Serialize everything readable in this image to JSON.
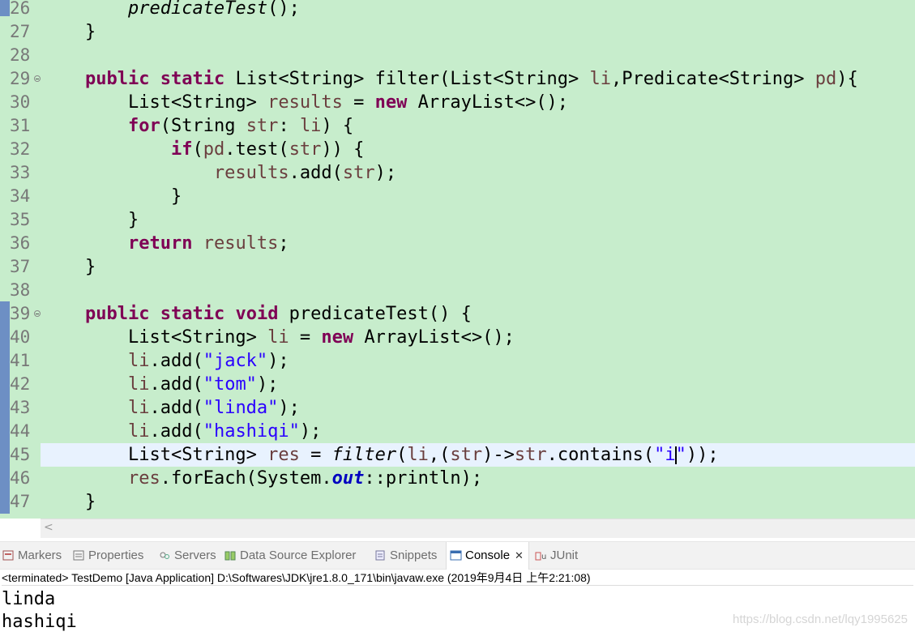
{
  "editor": {
    "line_numbers": [
      "26",
      "27",
      "28",
      "29",
      "30",
      "31",
      "32",
      "33",
      "34",
      "35",
      "36",
      "37",
      "38",
      "39",
      "40",
      "41",
      "42",
      "43",
      "44",
      "45",
      "46",
      "47"
    ]
  },
  "code": {
    "l26": {
      "call": "predicateTest",
      "tail": "();"
    },
    "l27": {
      "brace": "}"
    },
    "l29": {
      "kw1": "public",
      "kw2": "static",
      "sig": "List<String> filter(List<String> ",
      "p1": "li",
      "mid": ",Predicate<String> ",
      "p2": "pd",
      "end": "){"
    },
    "l30": {
      "type": "List<String> ",
      "var": "results",
      "eq": " = ",
      "kw": "new",
      "rest": " ArrayList<>();"
    },
    "l31": {
      "kw": "for",
      "open": "(String ",
      "v1": "str",
      "colon": ": ",
      "v2": "li",
      "close": ") {"
    },
    "l32": {
      "kw": "if",
      "open": "(",
      "v1": "pd",
      "dot": ".test(",
      "v2": "str",
      "close": ")) {"
    },
    "l33": {
      "v1": "results",
      "dot": ".add(",
      "v2": "str",
      "close": ");"
    },
    "l34": {
      "brace": "}"
    },
    "l35": {
      "brace": "}"
    },
    "l36": {
      "kw": "return",
      "var": "results",
      "semi": ";"
    },
    "l37": {
      "brace": "}"
    },
    "l39": {
      "kw1": "public",
      "kw2": "static",
      "kw3": "void",
      "sig": " predicateTest() {"
    },
    "l40": {
      "type": "List<String> ",
      "var": "li",
      "eq": " = ",
      "kw": "new",
      "rest": " ArrayList<>();"
    },
    "adds": [
      {
        "var": "li",
        "dot": ".add(",
        "str": "\"jack\"",
        "close": ");"
      },
      {
        "var": "li",
        "dot": ".add(",
        "str": "\"tom\"",
        "close": ");"
      },
      {
        "var": "li",
        "dot": ".add(",
        "str": "\"linda\"",
        "close": ");"
      },
      {
        "var": "li",
        "dot": ".add(",
        "str": "\"hashiqi\"",
        "close": ");"
      }
    ],
    "l45": {
      "type": "List<String> ",
      "var": "res",
      "eq": " = ",
      "call": "filter",
      "a": "(",
      "v1": "li",
      "b": ",(",
      "v2": "str",
      "c": ")->",
      "v3": "str",
      "d": ".contains(",
      "s1": "\"i",
      "s2": "\"",
      "end": "));"
    },
    "l46": {
      "var": "res",
      "a": ".forEach(System.",
      "field": "out",
      "b": "::println);"
    },
    "l47": {
      "brace": "}"
    }
  },
  "views": {
    "tabs": [
      {
        "label": "Markers",
        "icon": "markers-icon"
      },
      {
        "label": "Properties",
        "icon": "properties-icon"
      },
      {
        "label": "Servers",
        "icon": "servers-icon"
      },
      {
        "label": "Data Source Explorer",
        "icon": "data-source-icon"
      },
      {
        "label": "Snippets",
        "icon": "snippets-icon"
      },
      {
        "label": "Console",
        "icon": "console-icon",
        "active": true
      },
      {
        "label": "JUnit",
        "icon": "junit-icon"
      }
    ],
    "close_glyph": "✕"
  },
  "console": {
    "header": "<terminated> TestDemo [Java Application] D:\\Softwares\\JDK\\jre1.8.0_171\\bin\\javaw.exe (2019年9月4日 上午2:21:08)",
    "output": [
      "linda",
      "hashiqi"
    ]
  },
  "watermark": "https://blog.csdn.net/lqy1995625",
  "colors": {
    "editor_bg": "#c7edcc",
    "keyword": "#7f0055",
    "string": "#2a00ff",
    "local_var": "#6a3e3e",
    "field": "#0000c0"
  }
}
